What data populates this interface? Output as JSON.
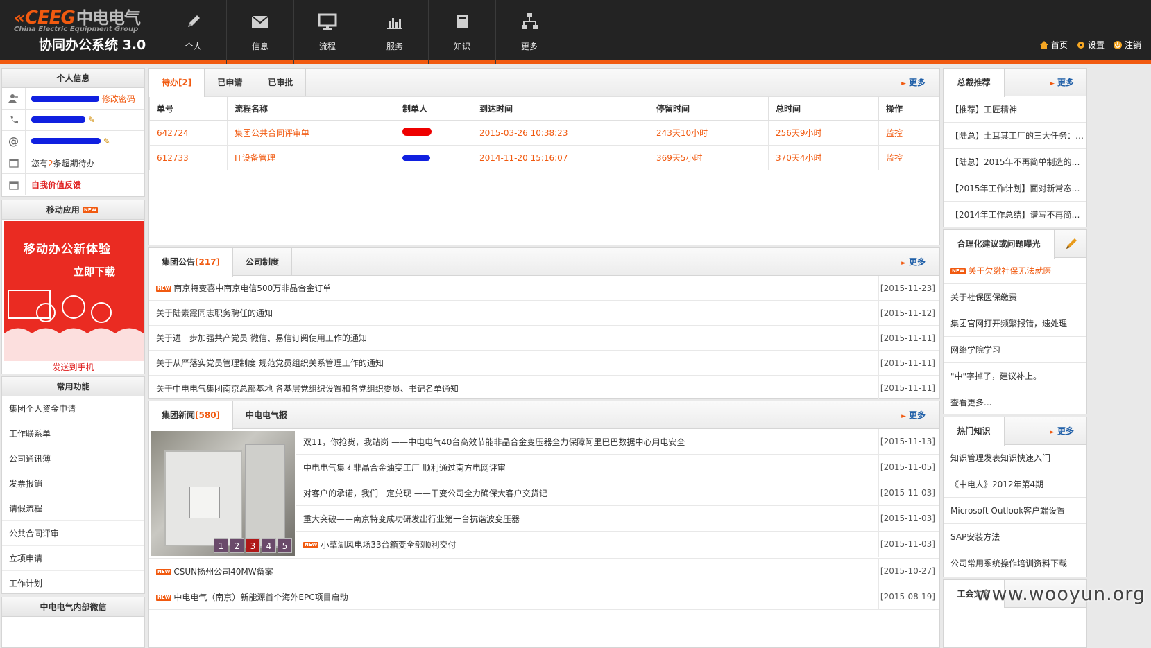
{
  "header": {
    "brand_en": "CEEG",
    "brand_cn": "中电电气",
    "brand_sub": "China Electric Equipment Group",
    "system_name": "协同办公系统 3.0",
    "nav": [
      {
        "label": "个人",
        "icon": "pencil-icon"
      },
      {
        "label": "信息",
        "icon": "envelope-icon"
      },
      {
        "label": "流程",
        "icon": "monitor-icon"
      },
      {
        "label": "服务",
        "icon": "bar-chart-icon"
      },
      {
        "label": "知识",
        "icon": "book-icon"
      },
      {
        "label": "更多",
        "icon": "sitemap-icon"
      }
    ],
    "links": {
      "home": "首页",
      "settings": "设置",
      "logout": "注销"
    }
  },
  "personal": {
    "title": "个人信息",
    "change_password": "修改密码",
    "pending_prefix": "您有",
    "pending_count": "2",
    "pending_suffix": "条超期待办",
    "feedback": "自我价值反馈"
  },
  "mobile": {
    "title": "移动应用",
    "badge": "NEW",
    "banner_line1": "移动办公新体验",
    "banner_line2": "立即下载",
    "send": "发送到手机"
  },
  "functions": {
    "title": "常用功能",
    "items": [
      "集团个人资金申请",
      "工作联系单",
      "公司通讯薄",
      "发票报销",
      "请假流程",
      "公共合同评审",
      "立项申请",
      "工作计划"
    ]
  },
  "wechat": {
    "title": "中电电气内部微信"
  },
  "todo": {
    "tabs": [
      "待办",
      "已申请",
      "已审批"
    ],
    "count": "[2]",
    "more": "更多",
    "columns": [
      "单号",
      "流程名称",
      "制单人",
      "到达时间",
      "停留时间",
      "总时间",
      "操作"
    ],
    "rows": [
      {
        "id": "642724",
        "flow": "集团公共合同评审单",
        "arrive": "2015-03-26 10:38:23",
        "stay": "243天10小时",
        "total": "256天9小时",
        "op": "监控"
      },
      {
        "id": "612733",
        "flow": "IT设备管理",
        "arrive": "2014-11-20 15:16:07",
        "stay": "369天5小时",
        "total": "370天4小时",
        "op": "监控"
      }
    ]
  },
  "notices": {
    "tabs": [
      "集团公告",
      "公司制度"
    ],
    "count": "[217]",
    "more": "更多",
    "items": [
      {
        "title": "南京特变喜中南京电信500万非晶合金订单",
        "date": "[2015-11-23]",
        "new": true
      },
      {
        "title": "关于陆素霞同志职务聘任的通知",
        "date": "[2015-11-12]",
        "new": false
      },
      {
        "title": "关于进一步加强共产党员 微信、易信订阅使用工作的通知",
        "date": "[2015-11-11]",
        "new": false
      },
      {
        "title": "关于从严落实党员管理制度 规范党员组织关系管理工作的通知",
        "date": "[2015-11-11]",
        "new": false
      },
      {
        "title": "关于中电电气集团南京总部基地 各基层党组织设置和各党组织委员、书记名单通知",
        "date": "[2015-11-11]",
        "new": false
      }
    ]
  },
  "news": {
    "tabs": [
      "集团新闻",
      "中电电气报"
    ],
    "count": "[580]",
    "more": "更多",
    "pager": [
      "1",
      "2",
      "3",
      "4",
      "5"
    ],
    "active_page": "3",
    "items": [
      {
        "title": "双11，你抢货，我站岗 ——中电电气40台高效节能非晶合金变压器全力保障阿里巴巴数据中心用电安全",
        "date": "[2015-11-13]",
        "new": false
      },
      {
        "title": "中电电气集团非晶合金油变工厂 顺利通过南方电网评审",
        "date": "[2015-11-05]",
        "new": false
      },
      {
        "title": "对客户的承诺，我们一定兑现 ——干变公司全力确保大客户交货记",
        "date": "[2015-11-03]",
        "new": false
      },
      {
        "title": "重大突破——南京特变成功研发出行业第一台抗谐波变压器",
        "date": "[2015-11-03]",
        "new": false
      },
      {
        "title": "小草湖风电场33台箱变全部顺利交付",
        "date": "[2015-11-03]",
        "new": true
      }
    ],
    "items_full": [
      {
        "title": "CSUN扬州公司40MW备案",
        "date": "[2015-10-27]",
        "new": true
      },
      {
        "title": "中电电气（南京）新能源首个海外EPC项目启动",
        "date": "[2015-08-19]",
        "new": true
      }
    ]
  },
  "ceo": {
    "title": "总裁推荐",
    "more": "更多",
    "items": [
      "【推荐】工匠精神",
      "【陆总】土耳其工厂的三大任务：…",
      "【陆总】2015年不再简单制造的…",
      "【2015年工作计划】面对新常态…",
      "【2014年工作总结】谱写不再简…"
    ]
  },
  "suggest": {
    "title": "合理化建议或问题曝光",
    "items": [
      {
        "text": "关于欠缴社保无法就医",
        "new": true
      },
      {
        "text": "关于社保医保缴费",
        "new": false
      },
      {
        "text": "集团官网打开频繁报错，速处理",
        "new": false
      },
      {
        "text": "网络学院学习",
        "new": false
      },
      {
        "text": "\"中\"字掉了，建议补上。",
        "new": false
      },
      {
        "text": "查看更多...",
        "new": false
      }
    ]
  },
  "knowledge": {
    "title": "热门知识",
    "more": "更多",
    "items": [
      "知识管理发表知识快速入门",
      "《中电人》2012年第4期",
      "Microsoft Outlook客户端设置",
      "SAP安装方法",
      "公司常用系统操作培训资料下载"
    ]
  },
  "bottom_right": {
    "title": "工会文窗"
  },
  "watermark": "www.wooyun.org",
  "colors": {
    "accent": "#f15a10",
    "header_bg": "#232323",
    "link_blue": "#1f5fa8"
  }
}
